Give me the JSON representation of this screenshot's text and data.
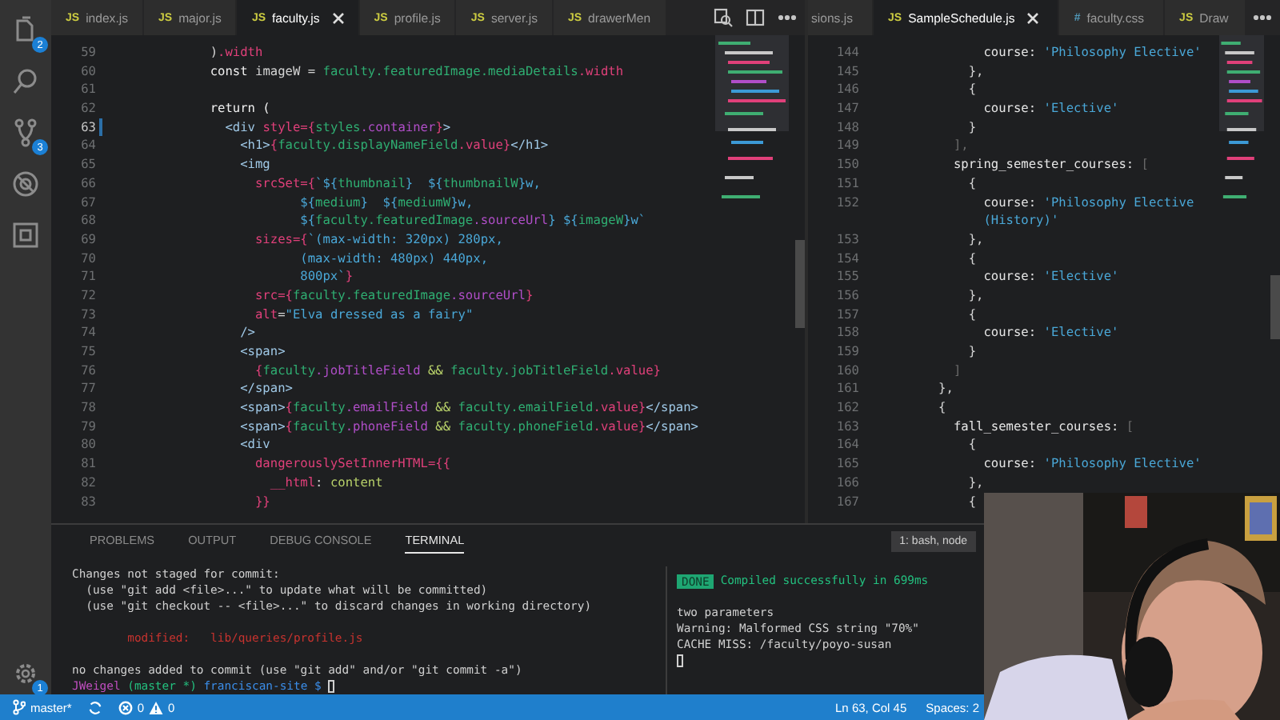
{
  "activity_bar": {
    "items": [
      {
        "kind": "files",
        "badge": "2"
      },
      {
        "kind": "search"
      },
      {
        "kind": "source-control",
        "badge": "3"
      },
      {
        "kind": "debug"
      },
      {
        "kind": "extensions"
      }
    ],
    "settings_badge": "1"
  },
  "editors": [
    {
      "tabs": [
        {
          "icon": "JS",
          "kind": "js",
          "label": "index.js",
          "selected": false
        },
        {
          "icon": "JS",
          "kind": "js",
          "label": "major.js",
          "selected": false
        },
        {
          "icon": "JS",
          "kind": "js",
          "label": "faculty.js",
          "selected": true
        },
        {
          "icon": "JS",
          "kind": "js",
          "label": "profile.js",
          "selected": false
        },
        {
          "icon": "JS",
          "kind": "js",
          "label": "server.js",
          "selected": false
        },
        {
          "icon": "JS",
          "kind": "js",
          "label": "drawerMen",
          "selected": false
        }
      ],
      "actions": [
        {
          "kind": "open-changes"
        },
        {
          "kind": "split"
        },
        {
          "kind": "more"
        }
      ],
      "lines": [
        {
          "number": "59",
          "active": false,
          "tokens": [
            {
              "text": "            )",
              "kind": "plain"
            },
            {
              "text": ".width",
              "kind": "member"
            }
          ]
        },
        {
          "number": "60",
          "active": false,
          "tokens": [
            {
              "text": "            const ",
              "kind": "kw"
            },
            {
              "text": "imageW = ",
              "kind": "plain"
            },
            {
              "text": "faculty.featuredImage.mediaDetails",
              "kind": "id"
            },
            {
              "text": ".width",
              "kind": "member"
            }
          ]
        },
        {
          "number": "61",
          "active": false
        },
        {
          "number": "62",
          "active": false,
          "tokens": [
            {
              "text": "            return (",
              "kind": "kw"
            }
          ]
        },
        {
          "number": "63",
          "active": true,
          "tokens": [
            {
              "text": "              <div ",
              "kind": "tag"
            },
            {
              "text": "style",
              "kind": "attr"
            },
            {
              "text": "={",
              "kind": "brace"
            },
            {
              "text": "styles",
              "kind": "id"
            },
            {
              "text": ".container",
              "kind": "prop"
            },
            {
              "text": "}",
              "kind": "brace"
            },
            {
              "text": ">",
              "kind": "tag"
            }
          ]
        },
        {
          "number": "64",
          "active": false,
          "tokens": [
            {
              "text": "                <h1>",
              "kind": "tag"
            },
            {
              "text": "{",
              "kind": "brace"
            },
            {
              "text": "faculty.displayNameField",
              "kind": "id"
            },
            {
              "text": ".value",
              "kind": "member"
            },
            {
              "text": "}",
              "kind": "brace"
            },
            {
              "text": "</h1>",
              "kind": "tag"
            }
          ]
        },
        {
          "number": "65",
          "active": false,
          "tokens": [
            {
              "text": "                <img",
              "kind": "tag"
            }
          ]
        },
        {
          "number": "66",
          "active": false,
          "tokens": [
            {
              "text": "                  srcSet",
              "kind": "attr"
            },
            {
              "text": "={",
              "kind": "brace"
            },
            {
              "text": "`${",
              "kind": "str"
            },
            {
              "text": "thumbnail",
              "kind": "id"
            },
            {
              "text": "}  ${",
              "kind": "str"
            },
            {
              "text": "thumbnailW",
              "kind": "id"
            },
            {
              "text": "}w,",
              "kind": "str"
            }
          ]
        },
        {
          "number": "67",
          "active": false,
          "tokens": [
            {
              "text": "                        ${",
              "kind": "str"
            },
            {
              "text": "medium",
              "kind": "id"
            },
            {
              "text": "}  ${",
              "kind": "str"
            },
            {
              "text": "mediumW",
              "kind": "id"
            },
            {
              "text": "}w,",
              "kind": "str"
            }
          ]
        },
        {
          "number": "68",
          "active": false,
          "tokens": [
            {
              "text": "                        ${",
              "kind": "str"
            },
            {
              "text": "faculty.featuredImage",
              "kind": "id"
            },
            {
              "text": ".sourceUrl",
              "kind": "prop"
            },
            {
              "text": "} ${",
              "kind": "str"
            },
            {
              "text": "imageW",
              "kind": "id"
            },
            {
              "text": "}w`",
              "kind": "str"
            }
          ]
        },
        {
          "number": "69",
          "active": false,
          "tokens": [
            {
              "text": "                  sizes",
              "kind": "attr"
            },
            {
              "text": "={",
              "kind": "brace"
            },
            {
              "text": "`(max-width: 320px) 280px,",
              "kind": "str"
            }
          ]
        },
        {
          "number": "70",
          "active": false,
          "tokens": [
            {
              "text": "                        (max-width: 480px) 440px,",
              "kind": "str"
            }
          ]
        },
        {
          "number": "71",
          "active": false,
          "tokens": [
            {
              "text": "                        800px`",
              "kind": "str"
            },
            {
              "text": "}",
              "kind": "brace"
            }
          ]
        },
        {
          "number": "72",
          "active": false,
          "tokens": [
            {
              "text": "                  src",
              "kind": "attr"
            },
            {
              "text": "={",
              "kind": "brace"
            },
            {
              "text": "faculty.featuredImage",
              "kind": "id"
            },
            {
              "text": ".sourceUrl",
              "kind": "prop"
            },
            {
              "text": "}",
              "kind": "brace"
            }
          ]
        },
        {
          "number": "73",
          "active": false,
          "tokens": [
            {
              "text": "                  alt",
              "kind": "attr"
            },
            {
              "text": "=",
              "kind": "plain"
            },
            {
              "text": "\"Elva dressed as a fairy\"",
              "kind": "str"
            }
          ]
        },
        {
          "number": "74",
          "active": false,
          "tokens": [
            {
              "text": "                />",
              "kind": "tag"
            }
          ]
        },
        {
          "number": "75",
          "active": false,
          "tokens": [
            {
              "text": "                <span>",
              "kind": "tag"
            }
          ]
        },
        {
          "number": "76",
          "active": false,
          "tokens": [
            {
              "text": "                  {",
              "kind": "brace"
            },
            {
              "text": "faculty",
              "kind": "id"
            },
            {
              "text": ".jobTitleField",
              "kind": "prop"
            },
            {
              "text": " && ",
              "kind": "op"
            },
            {
              "text": "faculty.jobTitleField",
              "kind": "id"
            },
            {
              "text": ".value",
              "kind": "member"
            },
            {
              "text": "}",
              "kind": "brace"
            }
          ]
        },
        {
          "number": "77",
          "active": false,
          "tokens": [
            {
              "text": "                </span>",
              "kind": "tag"
            }
          ]
        },
        {
          "number": "78",
          "active": false,
          "tokens": [
            {
              "text": "                <span>",
              "kind": "tag"
            },
            {
              "text": "{",
              "kind": "brace"
            },
            {
              "text": "faculty",
              "kind": "id"
            },
            {
              "text": ".emailField",
              "kind": "prop"
            },
            {
              "text": " && ",
              "kind": "op"
            },
            {
              "text": "faculty.emailField",
              "kind": "id"
            },
            {
              "text": ".value",
              "kind": "member"
            },
            {
              "text": "}",
              "kind": "brace"
            },
            {
              "text": "</span>",
              "kind": "tag"
            }
          ]
        },
        {
          "number": "79",
          "active": false,
          "tokens": [
            {
              "text": "                <span>",
              "kind": "tag"
            },
            {
              "text": "{",
              "kind": "brace"
            },
            {
              "text": "faculty",
              "kind": "id"
            },
            {
              "text": ".phoneField",
              "kind": "prop"
            },
            {
              "text": " && ",
              "kind": "op"
            },
            {
              "text": "faculty.phoneField",
              "kind": "id"
            },
            {
              "text": ".value",
              "kind": "member"
            },
            {
              "text": "}",
              "kind": "brace"
            },
            {
              "text": "</span>",
              "kind": "tag"
            }
          ]
        },
        {
          "number": "80",
          "active": false,
          "tokens": [
            {
              "text": "                <div",
              "kind": "tag"
            }
          ]
        },
        {
          "number": "81",
          "active": false,
          "tokens": [
            {
              "text": "                  dangerouslySetInnerHTML",
              "kind": "attr"
            },
            {
              "text": "={{",
              "kind": "brace"
            }
          ]
        },
        {
          "number": "82",
          "active": false,
          "tokens": [
            {
              "text": "                    __html",
              "kind": "attr"
            },
            {
              "text": ": ",
              "kind": "plain"
            },
            {
              "text": "content",
              "kind": "op"
            }
          ]
        },
        {
          "number": "83",
          "active": false,
          "tokens": [
            {
              "text": "                  }}",
              "kind": "brace"
            }
          ]
        }
      ]
    },
    {
      "tabs": [
        {
          "label": "sions.js",
          "selected": false
        },
        {
          "icon": "JS",
          "kind": "js",
          "label": "SampleSchedule.js",
          "selected": true
        },
        {
          "icon": "#",
          "kind": "css",
          "label": "faculty.css",
          "selected": false
        },
        {
          "icon": "JS",
          "kind": "js",
          "label": "Draw",
          "selected": false
        }
      ],
      "actions": [
        {
          "kind": "more"
        }
      ],
      "lines": [
        {
          "number": "144",
          "tokens": [
            {
              "text": "              course: ",
              "kind": "key"
            },
            {
              "text": "'Philosophy Elective'",
              "kind": "str"
            }
          ]
        },
        {
          "number": "145",
          "tokens": [
            {
              "text": "            },",
              "kind": "plain"
            }
          ]
        },
        {
          "number": "146",
          "tokens": [
            {
              "text": "            {",
              "kind": "plain"
            }
          ]
        },
        {
          "number": "147",
          "tokens": [
            {
              "text": "              course: ",
              "kind": "key"
            },
            {
              "text": "'Elective'",
              "kind": "str"
            }
          ]
        },
        {
          "number": "148",
          "tokens": [
            {
              "text": "            }",
              "kind": "plain"
            }
          ]
        },
        {
          "number": "149",
          "tokens": [
            {
              "text": "          ],",
              "kind": "dim"
            }
          ]
        },
        {
          "number": "150",
          "tokens": [
            {
              "text": "          spring_semester_courses: ",
              "kind": "key"
            },
            {
              "text": "[",
              "kind": "dim"
            }
          ]
        },
        {
          "number": "151",
          "tokens": [
            {
              "text": "            {",
              "kind": "plain"
            }
          ]
        },
        {
          "number": "152",
          "tokens": [
            {
              "text": "              course: ",
              "kind": "key"
            },
            {
              "text": "'Philosophy Elective",
              "kind": "str"
            }
          ],
          "wrap": [
            {
              "text": "              (History)'",
              "kind": "str"
            }
          ]
        },
        {
          "number": "153",
          "tokens": [
            {
              "text": "            },",
              "kind": "plain"
            }
          ]
        },
        {
          "number": "154",
          "tokens": [
            {
              "text": "            {",
              "kind": "plain"
            }
          ]
        },
        {
          "number": "155",
          "tokens": [
            {
              "text": "              course: ",
              "kind": "key"
            },
            {
              "text": "'Elective'",
              "kind": "str"
            }
          ]
        },
        {
          "number": "156",
          "tokens": [
            {
              "text": "            },",
              "kind": "plain"
            }
          ]
        },
        {
          "number": "157",
          "tokens": [
            {
              "text": "            {",
              "kind": "plain"
            }
          ]
        },
        {
          "number": "158",
          "tokens": [
            {
              "text": "              course: ",
              "kind": "key"
            },
            {
              "text": "'Elective'",
              "kind": "str"
            }
          ]
        },
        {
          "number": "159",
          "tokens": [
            {
              "text": "            }",
              "kind": "plain"
            }
          ]
        },
        {
          "number": "160",
          "tokens": [
            {
              "text": "          ]",
              "kind": "dim"
            }
          ]
        },
        {
          "number": "161",
          "tokens": [
            {
              "text": "        },",
              "kind": "plain"
            }
          ]
        },
        {
          "number": "162",
          "tokens": [
            {
              "text": "        {",
              "kind": "plain"
            }
          ]
        },
        {
          "number": "163",
          "tokens": [
            {
              "text": "          fall_semester_courses: ",
              "kind": "key"
            },
            {
              "text": "[",
              "kind": "dim"
            }
          ]
        },
        {
          "number": "164",
          "tokens": [
            {
              "text": "            {",
              "kind": "plain"
            }
          ]
        },
        {
          "number": "165",
          "tokens": [
            {
              "text": "              course: ",
              "kind": "key"
            },
            {
              "text": "'Philosophy Elective'",
              "kind": "str"
            }
          ]
        },
        {
          "number": "166",
          "tokens": [
            {
              "text": "            },",
              "kind": "plain"
            }
          ]
        },
        {
          "number": "167",
          "tokens": [
            {
              "text": "            {",
              "kind": "plain"
            }
          ]
        }
      ]
    }
  ],
  "panel": {
    "tabs": [
      {
        "label": "PROBLEMS",
        "selected": false
      },
      {
        "label": "OUTPUT",
        "selected": false
      },
      {
        "label": "DEBUG CONSOLE",
        "selected": false
      },
      {
        "label": "TERMINAL",
        "selected": true
      }
    ],
    "terminal_select": "1: bash, node",
    "terminals": [
      {
        "lines": [
          {
            "segments": [
              {
                "text": "Changes not staged for commit:",
                "kind": "plain"
              }
            ],
            "cursor": false
          },
          {
            "segments": [
              {
                "text": "  (use \"git add <file>...\" to update what will be committed)",
                "kind": "plain"
              }
            ],
            "cursor": false
          },
          {
            "segments": [
              {
                "text": "  (use \"git checkout -- <file>...\" to discard changes in working directory)",
                "kind": "plain"
              }
            ],
            "cursor": false
          },
          {
            "cursor": false
          },
          {
            "segments": [
              {
                "text": "        modified:   lib/queries/profile.js",
                "kind": "error"
              }
            ],
            "cursor": false
          },
          {
            "cursor": false
          },
          {
            "segments": [
              {
                "text": "no changes added to commit (use \"git add\" and/or \"git commit -a\")",
                "kind": "plain"
              }
            ],
            "cursor": false
          },
          {
            "segments": [
              {
                "text": "JWeigel",
                "kind": "user"
              },
              {
                "text": " (master *)",
                "kind": "branch"
              },
              {
                "text": " franciscan-site",
                "kind": "path"
              },
              {
                "text": " $",
                "kind": "path"
              }
            ],
            "cursor": true
          }
        ]
      },
      {
        "lines": [
          {
            "badge": "DONE",
            "segments": [
              {
                "text": "Compiled successfully in 699ms",
                "kind": "success"
              }
            ],
            "cursor": false
          },
          {
            "cursor": false
          },
          {
            "segments": [
              {
                "text": "two parameters",
                "kind": "plain"
              }
            ],
            "cursor": false
          },
          {
            "segments": [
              {
                "text": "Warning: Malformed CSS string \"70%\"",
                "kind": "plain"
              }
            ],
            "cursor": false
          },
          {
            "segments": [
              {
                "text": "CACHE MISS: /faculty/poyo-susan",
                "kind": "plain"
              }
            ],
            "cursor": false
          },
          {
            "cursor": true
          }
        ]
      }
    ]
  },
  "status_bar": {
    "branch": "master*",
    "errors": "0",
    "warnings": "0",
    "position": "Ln 63, Col 45",
    "indent": "Spaces: 2"
  }
}
